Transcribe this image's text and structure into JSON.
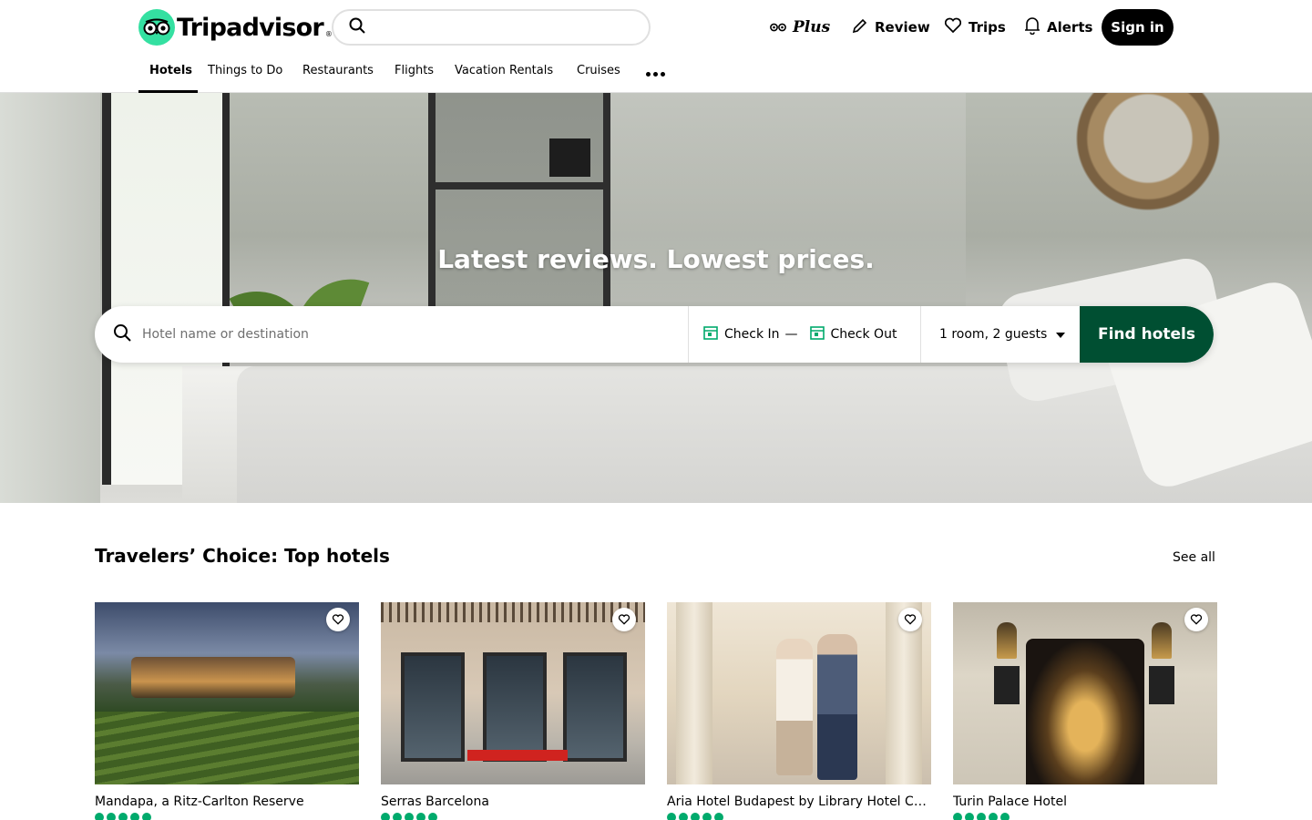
{
  "header": {
    "logo_text": "Tripadvisor",
    "logo_tm": "®",
    "search_placeholder": "",
    "actions": {
      "plus_label": "Plus",
      "review_label": "Review",
      "trips_label": "Trips",
      "alerts_label": "Alerts",
      "signin_label": "Sign in"
    },
    "tabs": [
      {
        "label": "Hotels",
        "active": true
      },
      {
        "label": "Things to Do"
      },
      {
        "label": "Restaurants"
      },
      {
        "label": "Flights"
      },
      {
        "label": "Vacation Rentals"
      },
      {
        "label": "Cruises"
      }
    ],
    "more_icon": "more-dots-icon"
  },
  "hero": {
    "title": "Latest reviews. Lowest prices.",
    "search": {
      "destination_placeholder": "Hotel name or destination",
      "check_in": "Check In",
      "dash": "—",
      "check_out": "Check Out",
      "guests": "1 room, 2 guests",
      "find_button": "Find hotels"
    }
  },
  "travelers_choice": {
    "title": "Travelers’ Choice: Top hotels",
    "see_all": "See all",
    "hotels": [
      {
        "name": "Mandapa, a Ritz-Carlton Reserve"
      },
      {
        "name": "Serras Barcelona"
      },
      {
        "name": "Aria Hotel Budapest by Library Hotel Collection"
      },
      {
        "name": "Turin Palace Hotel"
      }
    ]
  },
  "colors": {
    "brand_green": "#34e0a1",
    "find_button_bg": "#004f32",
    "rating_green": "#00aa6c",
    "signin_bg": "#000000"
  }
}
